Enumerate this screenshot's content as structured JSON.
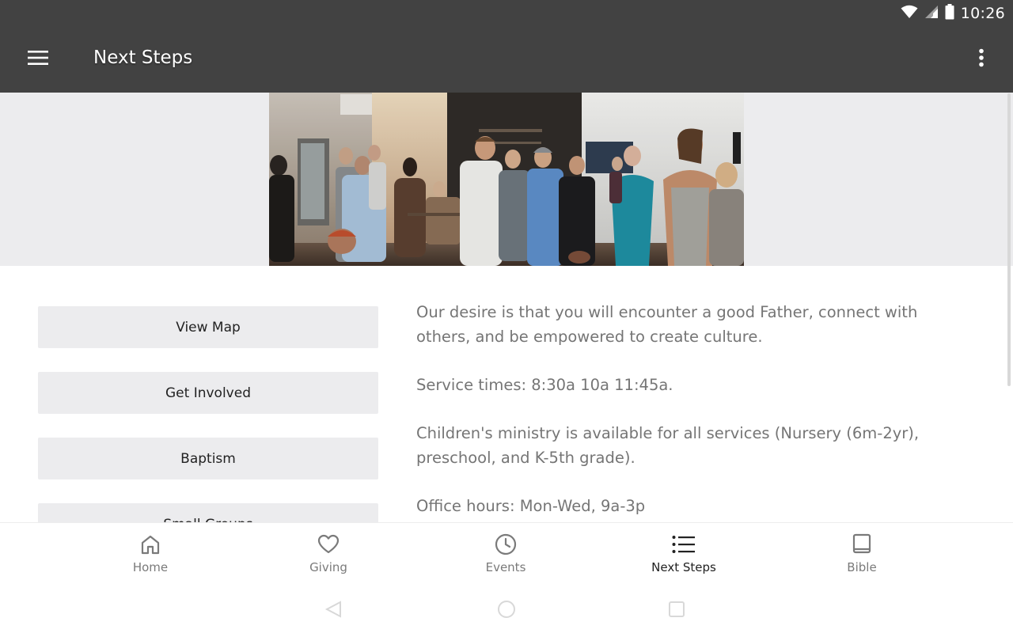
{
  "status": {
    "time": "10:26"
  },
  "app_bar": {
    "title": "Next Steps"
  },
  "buttons": [
    {
      "label": "View Map"
    },
    {
      "label": "Get Involved"
    },
    {
      "label": "Baptism"
    },
    {
      "label": "Small Groups"
    }
  ],
  "description": {
    "paragraphs": [
      "Our desire is that you will encounter a good Father, connect with others, and be empowered to create culture.",
      "Service times: 8:30a 10a 11:45a.",
      "Children's ministry is available for all services (Nursery (6m-2yr), preschool, and K-5th grade).",
      "Office hours: Mon-Wed, 9a-3p"
    ]
  },
  "bottom_nav": {
    "active": "Next Steps",
    "items": [
      {
        "label": "Home",
        "icon": "home-icon"
      },
      {
        "label": "Giving",
        "icon": "heart-icon"
      },
      {
        "label": "Events",
        "icon": "clock-icon"
      },
      {
        "label": "Next Steps",
        "icon": "list-icon"
      },
      {
        "label": "Bible",
        "icon": "book-icon"
      }
    ]
  },
  "colors": {
    "app_bar": "#424242",
    "hero_band": "#ececee",
    "button_bg": "#ececee",
    "body_text": "#757575",
    "nav_inactive": "#7a7a7a",
    "nav_active": "#222222"
  }
}
